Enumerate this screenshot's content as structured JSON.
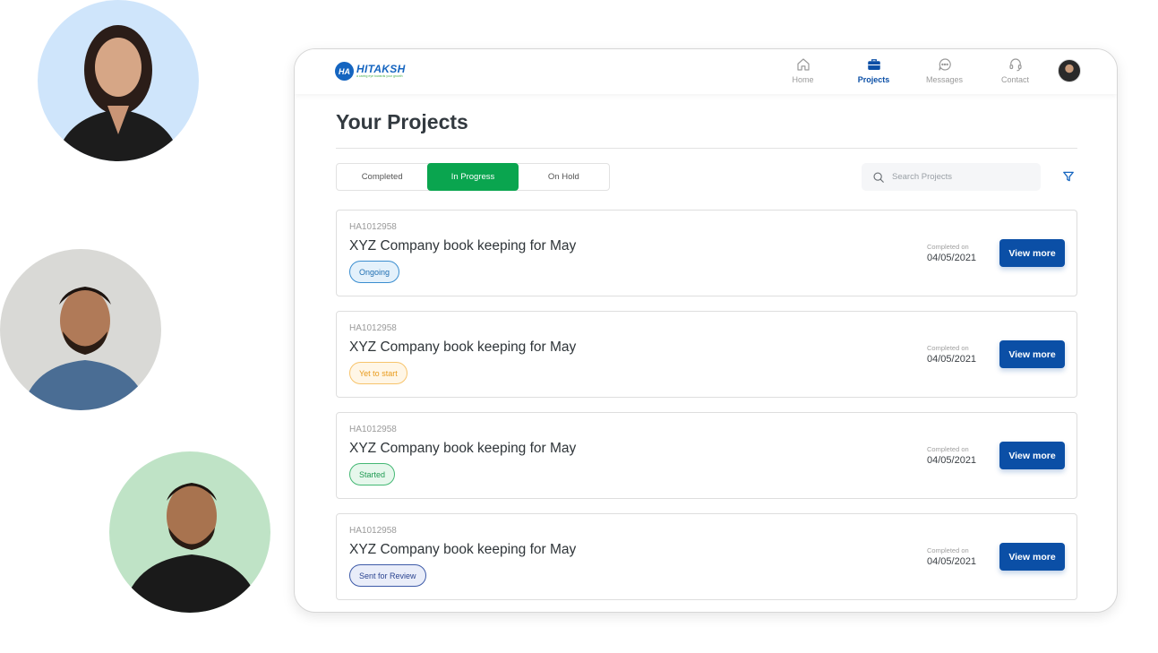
{
  "brand": {
    "name": "HITAKSH",
    "mark": "HA",
    "tagline": "a caring eye towards your growth"
  },
  "nav": {
    "items": [
      {
        "label": "Home",
        "icon": "home-icon",
        "active": false
      },
      {
        "label": "Projects",
        "icon": "briefcase-icon",
        "active": true
      },
      {
        "label": "Messages",
        "icon": "chat-bubble-icon",
        "active": false
      },
      {
        "label": "Contact",
        "icon": "headset-icon",
        "active": false
      }
    ]
  },
  "page": {
    "title": "Your Projects"
  },
  "tabs": [
    {
      "label": "Completed",
      "active": false
    },
    {
      "label": "In Progress",
      "active": true
    },
    {
      "label": "On Hold",
      "active": false
    }
  ],
  "search": {
    "placeholder": "Search Projects",
    "value": ""
  },
  "projects": [
    {
      "id": "HA1012958",
      "title": "XYZ Company book keeping for May",
      "status": "Ongoing",
      "date_label": "Completed on",
      "date": "04/05/2021",
      "action": "View more"
    },
    {
      "id": "HA1012958",
      "title": "XYZ Company book keeping for May",
      "status": "Yet to start",
      "date_label": "Completed on",
      "date": "04/05/2021",
      "action": "View more"
    },
    {
      "id": "HA1012958",
      "title": "XYZ Company book keeping for May",
      "status": "Started",
      "date_label": "Completed on",
      "date": "04/05/2021",
      "action": "View more"
    },
    {
      "id": "HA1012958",
      "title": "XYZ Company book keeping for May",
      "status": "Sent for Review",
      "date_label": "Completed on",
      "date": "04/05/2021",
      "action": "View more"
    }
  ],
  "colors": {
    "primary": "#0b4fa6",
    "active_tab": "#0aa54f"
  }
}
